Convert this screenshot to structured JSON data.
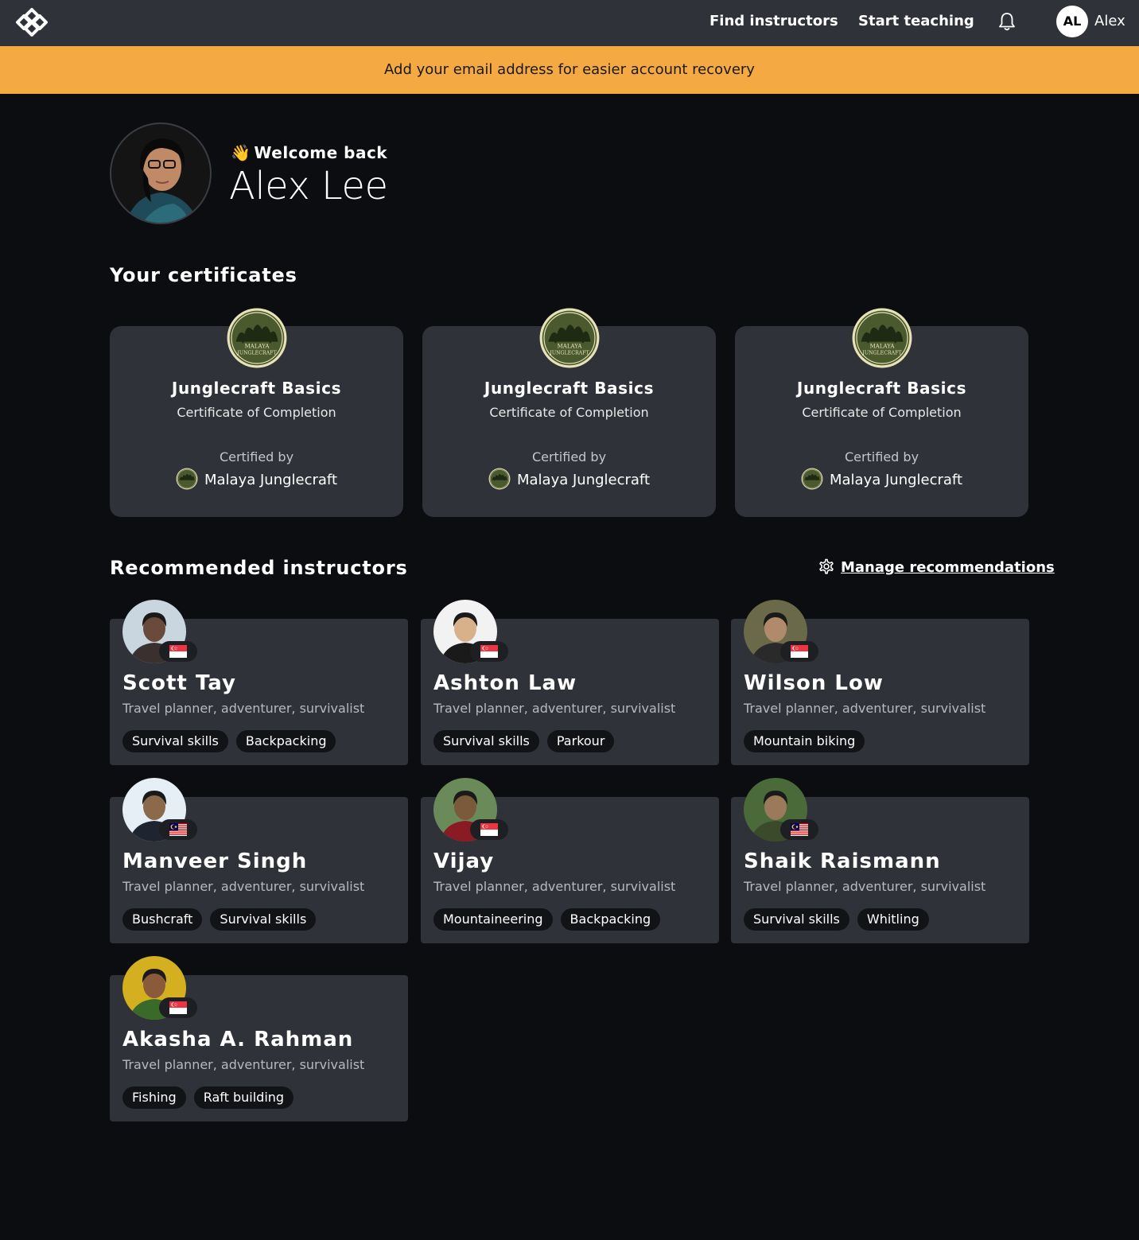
{
  "nav": {
    "find_instructors": "Find instructors",
    "start_teaching": "Start teaching",
    "user_initials": "AL",
    "user_name": "Alex"
  },
  "banner": {
    "text": "Add your email address for easier account recovery"
  },
  "profile": {
    "welcome": "Welcome back",
    "wave_emoji": "👋",
    "full_name": "Alex Lee"
  },
  "certificates": {
    "section_title": "Your certificates",
    "items": [
      {
        "title": "Junglecraft Basics",
        "subtitle": "Certificate of Completion",
        "certified_by_label": "Certified by",
        "issuer": "Malaya Junglecraft"
      },
      {
        "title": "Junglecraft Basics",
        "subtitle": "Certificate of Completion",
        "certified_by_label": "Certified by",
        "issuer": "Malaya Junglecraft"
      },
      {
        "title": "Junglecraft Basics",
        "subtitle": "Certificate of Completion",
        "certified_by_label": "Certified by",
        "issuer": "Malaya Junglecraft"
      }
    ],
    "seal_text_line1": "MALAYA",
    "seal_text_line2": "JUNGLECRAFT"
  },
  "instructors": {
    "section_title": "Recommended instructors",
    "manage_label": "Manage recommendations",
    "items": [
      {
        "name": "Scott Tay",
        "role": "Travel planner, adventurer, survivalist",
        "flag": "singapore-flag-icon",
        "tags": [
          "Survival skills",
          "Backpacking"
        ]
      },
      {
        "name": "Ashton Law",
        "role": "Travel planner, adventurer, survivalist",
        "flag": "singapore-flag-icon",
        "tags": [
          "Survival skills",
          "Parkour"
        ]
      },
      {
        "name": "Wilson Low",
        "role": "Travel planner, adventurer, survivalist",
        "flag": "singapore-flag-icon",
        "tags": [
          "Mountain biking"
        ]
      },
      {
        "name": "Manveer Singh",
        "role": "Travel planner, adventurer, survivalist",
        "flag": "malaysia-flag-icon",
        "tags": [
          "Bushcraft",
          "Survival skills"
        ]
      },
      {
        "name": "Vijay",
        "role": "Travel planner, adventurer, survivalist",
        "flag": "singapore-flag-icon",
        "tags": [
          "Mountaineering",
          "Backpacking"
        ]
      },
      {
        "name": "Shaik Raismann",
        "role": "Travel planner, adventurer, survivalist",
        "flag": "malaysia-flag-icon",
        "tags": [
          "Survival skills",
          "Whitling"
        ]
      },
      {
        "name": "Akasha A. Rahman",
        "role": "Travel planner, adventurer, survivalist",
        "flag": "singapore-flag-icon",
        "tags": [
          "Fishing",
          "Raft building"
        ]
      }
    ]
  },
  "colors": {
    "page_bg": "#0c0d10",
    "card_bg": "#2f3238",
    "banner_bg": "#f4a942",
    "tag_bg": "#121316",
    "seal_green": "#4a5a2e",
    "seal_cream": "#e8e2b8"
  }
}
